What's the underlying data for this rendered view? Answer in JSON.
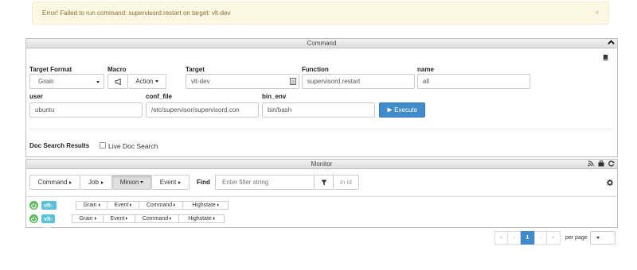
{
  "alert": {
    "message": "Error! Failed to run command: supervisord.restart on target: vlt-dev",
    "close": "×"
  },
  "command_panel": {
    "title": "Command",
    "labels": {
      "target_format": "Target Format",
      "macro": "Macro",
      "target": "Target",
      "function": "Function",
      "name": "name",
      "user": "user",
      "conf_file": "conf_file",
      "bin_env": "bin_env"
    },
    "values": {
      "target_format": "Grain",
      "action": "Action",
      "target": "vlt-dev",
      "function": "supervisord.restart",
      "name": "all",
      "user": "ubuntu",
      "conf_file": "/etc/supervisor/supervisord.con",
      "bin_env": "bin/bash"
    },
    "execute_label": "Execute",
    "doc_search_results": "Doc Search Results",
    "live_doc_search": "Live Doc Search"
  },
  "monitor_panel": {
    "title": "Monitor",
    "tabs": [
      "Command",
      "Job",
      "Minion",
      "Event"
    ],
    "active_tab": "Minion",
    "find_label": "Find",
    "filter_placeholder": "Enter filter string",
    "in_id": "in id",
    "minions": [
      {
        "id": "vlt-dev",
        "actions": [
          "Grain",
          "Event",
          "Command",
          "Highstate"
        ]
      },
      {
        "id": "vlt-qa",
        "actions": [
          "Grain",
          "Event",
          "Command",
          "Highstate"
        ]
      }
    ]
  },
  "pagination": {
    "first": "«",
    "prev": "‹",
    "current": "1",
    "next": "›",
    "last": "»",
    "per_page_label": "per page"
  },
  "colors": {
    "primary": "#428bca",
    "success": "#5cb85c",
    "info": "#5bc0de",
    "alert_bg": "#fcf8e3",
    "alert_text": "#8a6d3b"
  }
}
